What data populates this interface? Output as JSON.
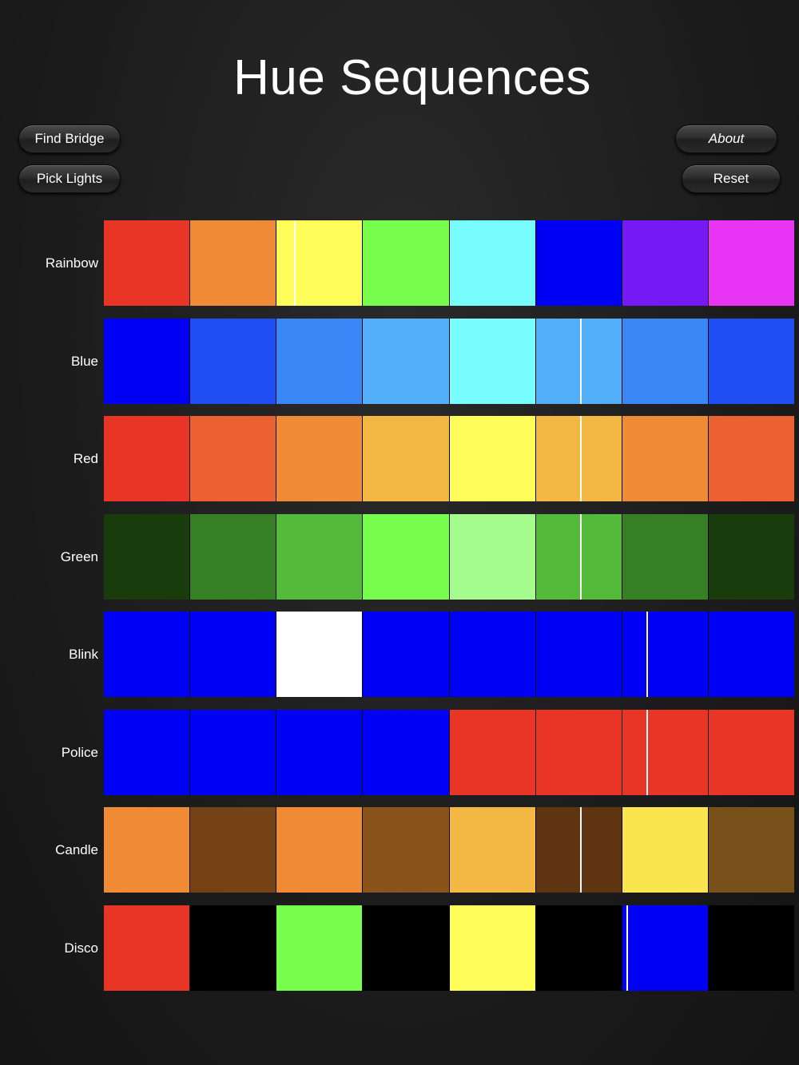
{
  "title": "Hue Sequences",
  "buttons": {
    "find_bridge": "Find Bridge",
    "pick_lights": "Pick Lights",
    "about": "About",
    "reset": "Reset"
  },
  "sequences": [
    {
      "name": "Rainbow",
      "colors": [
        "#e93526",
        "#ef8b35",
        "#fefd59",
        "#77fd4b",
        "#78fdfe",
        "#0000f5",
        "#7519f5",
        "#e933f5"
      ],
      "progress_step": 2,
      "progress_fraction": 0.2
    },
    {
      "name": "Blue",
      "colors": [
        "#0000f5",
        "#1f4ef5",
        "#3987f6",
        "#52aef9",
        "#78fdfe",
        "#52aef9",
        "#3987f6",
        "#1f4ef5"
      ],
      "progress_step": 5,
      "progress_fraction": 0.52
    },
    {
      "name": "Red",
      "colors": [
        "#e93526",
        "#eb6230",
        "#ef8b35",
        "#f3b744",
        "#fefd59",
        "#f3b744",
        "#ef8b35",
        "#eb6230"
      ],
      "progress_step": 5,
      "progress_fraction": 0.52
    },
    {
      "name": "Green",
      "colors": [
        "#183c0b",
        "#377f25",
        "#53ba3a",
        "#77fd4b",
        "#a3fc8c",
        "#53ba3a",
        "#377f25",
        "#183c0b"
      ],
      "progress_step": 5,
      "progress_fraction": 0.52
    },
    {
      "name": "Blink",
      "colors": [
        "#0000f5",
        "#0000f5",
        "#ffffff",
        "#0000f5",
        "#0000f5",
        "#0000f5",
        "#0000f5",
        "#0000f5"
      ],
      "progress_step": 6,
      "progress_fraction": 0.28
    },
    {
      "name": "Police",
      "colors": [
        "#0000f5",
        "#0000f5",
        "#0000f5",
        "#0000f5",
        "#e93526",
        "#e93526",
        "#e93526",
        "#e93526"
      ],
      "progress_step": 6,
      "progress_fraction": 0.28
    },
    {
      "name": "Candle",
      "colors": [
        "#ef8b35",
        "#754215",
        "#ef8b35",
        "#8b531c",
        "#f3b744",
        "#5e3510",
        "#fbe54f",
        "#78511a"
      ],
      "progress_step": 5,
      "progress_fraction": 0.52
    },
    {
      "name": "Disco",
      "colors": [
        "#e93526",
        "#000000",
        "#77fd4b",
        "#000000",
        "#fefd59",
        "#000000",
        "#0000f5",
        "#000000"
      ],
      "progress_step": 6,
      "progress_fraction": 0.05
    }
  ]
}
